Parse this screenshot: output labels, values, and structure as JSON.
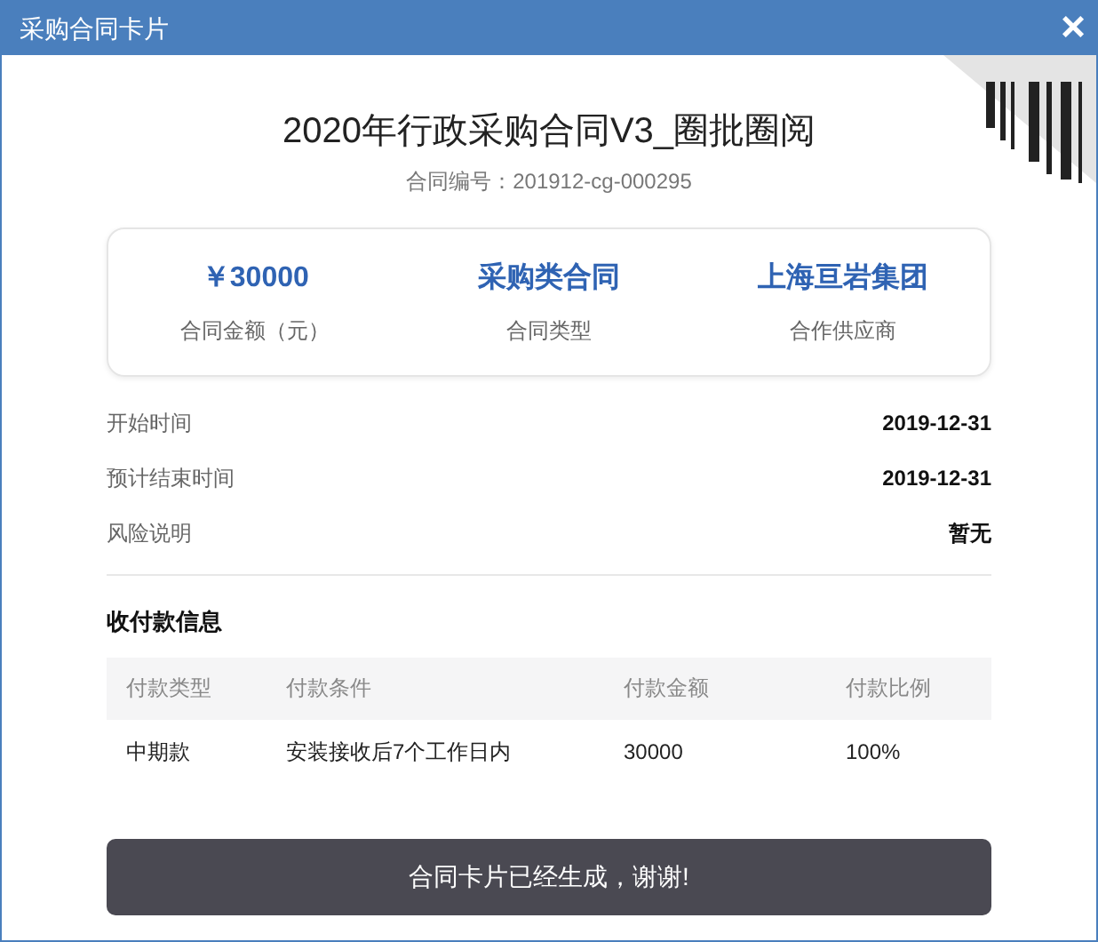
{
  "window": {
    "title": "采购合同卡片",
    "close": "×"
  },
  "contract": {
    "title": "2020年行政采购合同V3_圈批圈阅",
    "number_label": "合同编号：",
    "number": "201912-cg-000295"
  },
  "summary": [
    {
      "value": "￥30000",
      "label": "合同金额（元）"
    },
    {
      "value": "采购类合同",
      "label": "合同类型"
    },
    {
      "value": "上海亘岩集团",
      "label": "合作供应商"
    }
  ],
  "details": [
    {
      "label": "开始时间",
      "value": "2019-12-31"
    },
    {
      "label": "预计结束时间",
      "value": "2019-12-31"
    },
    {
      "label": "风险说明",
      "value": "暂无"
    }
  ],
  "payments": {
    "heading": "收付款信息",
    "columns": [
      "付款类型",
      "付款条件",
      "付款金额",
      "付款比例"
    ],
    "rows": [
      [
        "中期款",
        "安装接收后7个工作日内",
        "30000",
        "100%"
      ]
    ]
  },
  "button": "合同卡片已经生成，谢谢!"
}
